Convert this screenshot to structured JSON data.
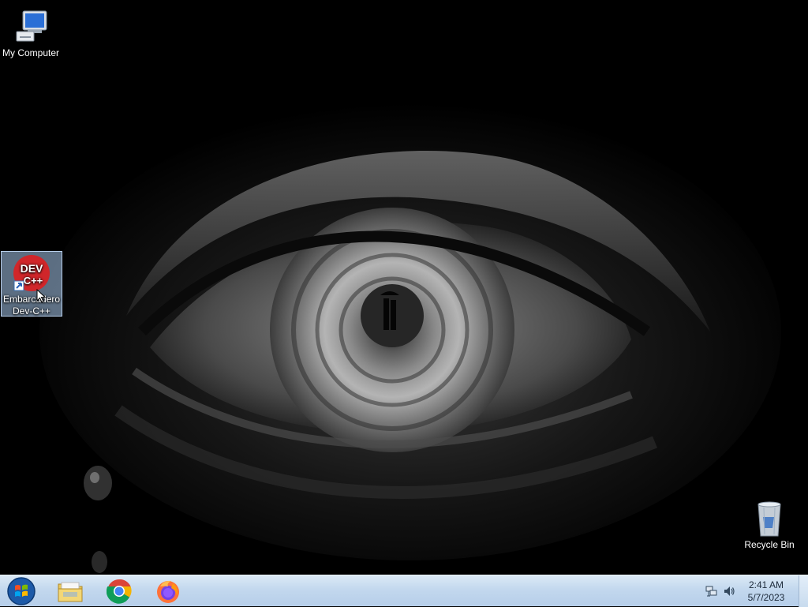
{
  "desktop": {
    "icons": [
      {
        "label": "My Computer",
        "icon": "computer-icon"
      },
      {
        "label": "Embarcadero Dev-C++",
        "icon": "devcpp-icon",
        "badge_top": "DEV",
        "badge_bottom": "C++"
      },
      {
        "label": "Recycle Bin",
        "icon": "recycle-bin-icon"
      }
    ],
    "wallpaper": "dark-eye-wallpaper"
  },
  "taskbar": {
    "start_icon": "windows-orb-icon",
    "pinned": [
      {
        "name": "File Explorer",
        "icon": "folder-icon"
      },
      {
        "name": "Google Chrome",
        "icon": "chrome-icon"
      },
      {
        "name": "Firefox",
        "icon": "firefox-icon"
      }
    ],
    "tray": {
      "network_icon": "network-icon",
      "volume_icon": "volume-icon",
      "time": "2:41 AM",
      "date": "5/7/2023"
    }
  },
  "colors": {
    "taskbar_top": "#dbe9f6",
    "taskbar_bottom": "#b6cee9",
    "selection": "#a8c8ec",
    "devcpp_red": "#d0262a"
  }
}
